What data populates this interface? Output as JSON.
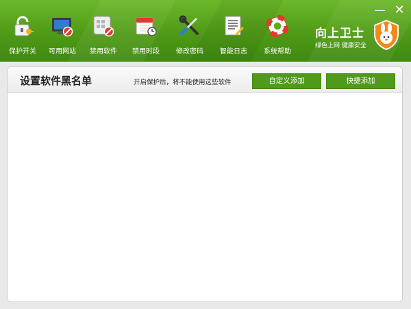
{
  "window": {
    "minimize_glyph": "—",
    "close_glyph": "✕"
  },
  "toolbar": {
    "items": [
      {
        "label": "保护开关",
        "icon": "lock-key-icon"
      },
      {
        "label": "可用网站",
        "icon": "monitor-blocked-icon"
      },
      {
        "label": "禁用软件",
        "icon": "app-grid-blocked-icon"
      },
      {
        "label": "禁用时段",
        "icon": "calendar-clock-icon"
      },
      {
        "label": "修改密码",
        "icon": "wrench-screwdriver-icon"
      },
      {
        "label": "智能日志",
        "icon": "log-document-icon"
      },
      {
        "label": "系统帮助",
        "icon": "lifebuoy-icon"
      }
    ]
  },
  "brand": {
    "name": "向上卫士",
    "slogan": "绿色上网 健康安全",
    "logo_icon": "rabbit-shield-logo"
  },
  "panel": {
    "title": "设置软件黑名单",
    "note": "开启保护后，将不能使用这些软件",
    "buttons": {
      "custom_add": "自定义添加",
      "quick_add": "快捷添加"
    }
  },
  "colors": {
    "brand_green": "#5aaa1e",
    "button_green": "#4f9a1a",
    "logo_orange": "#f28a1a",
    "block_red": "#e23b2e"
  }
}
